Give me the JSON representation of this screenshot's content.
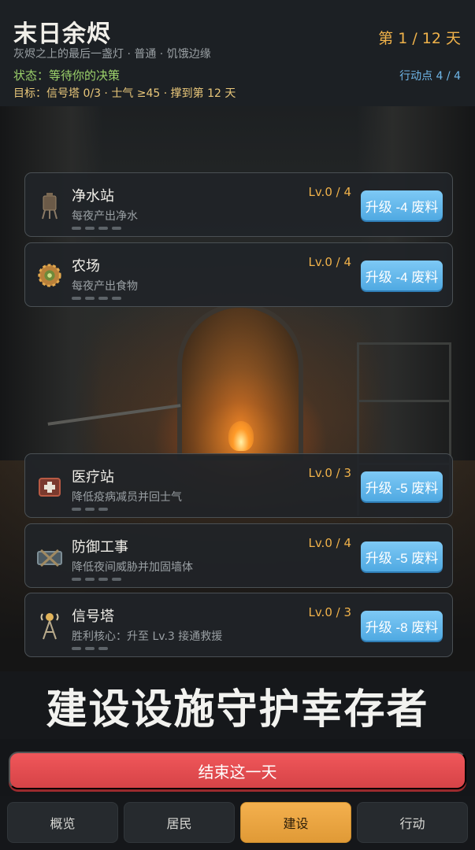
{
  "header": {
    "title": "末日余烬",
    "subtitle": "灰烬之上的最后一盏灯 · 普通 · 饥饿边缘",
    "status": "状态：等待你的决策",
    "goal": "目标：信号塔 0/3 · 士气 ≥45 · 撑到第 12 天",
    "day": "第 1 / 12 天",
    "action_points": "行动点 4 / 4"
  },
  "buildings": [
    {
      "name": "净水站",
      "desc": "每夜产出净水",
      "level": "Lv.0 / 4",
      "upgrade": "升级 -4 废料",
      "level_value": 0,
      "level_max": 4,
      "icon": "water-tower-icon"
    },
    {
      "name": "农场",
      "desc": "每夜产出食物",
      "level": "Lv.0 / 4",
      "upgrade": "升级 -4 废料",
      "level_value": 0,
      "level_max": 4,
      "icon": "farm-gear-icon"
    },
    {
      "name": "医疗站",
      "desc": "降低疫病减员并回士气",
      "level": "Lv.0 / 3",
      "upgrade": "升级 -5 废料",
      "level_value": 0,
      "level_max": 3,
      "icon": "medkit-icon"
    },
    {
      "name": "防御工事",
      "desc": "降低夜间威胁并加固墙体",
      "level": "Lv.0 / 4",
      "upgrade": "升级 -5 废料",
      "level_value": 0,
      "level_max": 4,
      "icon": "barricade-icon"
    },
    {
      "name": "信号塔",
      "desc": "胜利核心：升至 Lv.3 接通救援",
      "level": "Lv.0 / 3",
      "upgrade": "升级 -8 废料",
      "level_value": 0,
      "level_max": 3,
      "icon": "signal-tower-icon"
    }
  ],
  "banner": "建设设施守护幸存者",
  "end_day": "结束这一天",
  "nav": {
    "tabs": [
      "概览",
      "居民",
      "建设",
      "行动"
    ],
    "active": "建设"
  },
  "colors": {
    "accent_orange": "#f0b24a",
    "status_green": "#9dd36b",
    "upgrade_blue": "#4fa9e2",
    "end_day_red": "#d64347"
  }
}
